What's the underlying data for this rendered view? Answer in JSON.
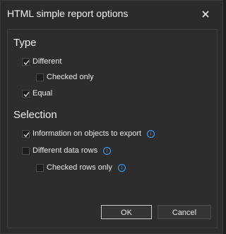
{
  "window": {
    "title": "HTML simple report options"
  },
  "icons": {
    "close": "close-icon",
    "info": "info-icon",
    "check": "checkmark-icon"
  },
  "colors": {
    "accent": "#3aa0ff",
    "background": "#2b2b2b"
  },
  "type": {
    "title": "Type",
    "options": [
      {
        "label": "Different",
        "checked": true
      },
      {
        "label": "Checked only",
        "checked": false
      },
      {
        "label": "Equal",
        "checked": true
      }
    ]
  },
  "selection": {
    "title": "Selection",
    "options": [
      {
        "label": "Information on objects to export",
        "checked": true
      },
      {
        "label": "Different data rows",
        "checked": false
      },
      {
        "label": "Checked rows only",
        "checked": false
      }
    ]
  },
  "buttons": {
    "ok": "OK",
    "cancel": "Cancel"
  }
}
